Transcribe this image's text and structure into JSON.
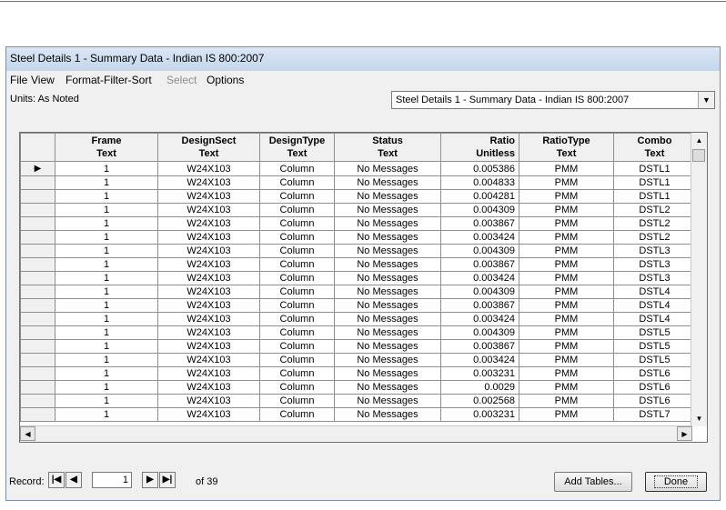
{
  "window": {
    "title": "Steel Details 1 - Summary Data - Indian IS 800:2007"
  },
  "menu": [
    {
      "label": "File",
      "enabled": true
    },
    {
      "label": "View",
      "enabled": true
    },
    {
      "label": "Format-Filter-Sort",
      "enabled": true
    },
    {
      "label": "Select",
      "enabled": false
    },
    {
      "label": "Options",
      "enabled": true
    }
  ],
  "units_label": "Units: As Noted",
  "table_select": {
    "value": "Steel Details 1 - Summary Data - Indian IS 800:2007"
  },
  "grid": {
    "columns": [
      {
        "name": "Frame",
        "unit": "Text"
      },
      {
        "name": "DesignSect",
        "unit": "Text"
      },
      {
        "name": "DesignType",
        "unit": "Text"
      },
      {
        "name": "Status",
        "unit": "Text"
      },
      {
        "name": "Ratio",
        "unit": "Unitless"
      },
      {
        "name": "RatioType",
        "unit": "Text"
      },
      {
        "name": "Combo",
        "unit": "Text"
      }
    ],
    "rows": [
      [
        "1",
        "W24X103",
        "Column",
        "No Messages",
        "0.005386",
        "PMM",
        "DSTL1"
      ],
      [
        "1",
        "W24X103",
        "Column",
        "No Messages",
        "0.004833",
        "PMM",
        "DSTL1"
      ],
      [
        "1",
        "W24X103",
        "Column",
        "No Messages",
        "0.004281",
        "PMM",
        "DSTL1"
      ],
      [
        "1",
        "W24X103",
        "Column",
        "No Messages",
        "0.004309",
        "PMM",
        "DSTL2"
      ],
      [
        "1",
        "W24X103",
        "Column",
        "No Messages",
        "0.003867",
        "PMM",
        "DSTL2"
      ],
      [
        "1",
        "W24X103",
        "Column",
        "No Messages",
        "0.003424",
        "PMM",
        "DSTL2"
      ],
      [
        "1",
        "W24X103",
        "Column",
        "No Messages",
        "0.004309",
        "PMM",
        "DSTL3"
      ],
      [
        "1",
        "W24X103",
        "Column",
        "No Messages",
        "0.003867",
        "PMM",
        "DSTL3"
      ],
      [
        "1",
        "W24X103",
        "Column",
        "No Messages",
        "0.003424",
        "PMM",
        "DSTL3"
      ],
      [
        "1",
        "W24X103",
        "Column",
        "No Messages",
        "0.004309",
        "PMM",
        "DSTL4"
      ],
      [
        "1",
        "W24X103",
        "Column",
        "No Messages",
        "0.003867",
        "PMM",
        "DSTL4"
      ],
      [
        "1",
        "W24X103",
        "Column",
        "No Messages",
        "0.003424",
        "PMM",
        "DSTL4"
      ],
      [
        "1",
        "W24X103",
        "Column",
        "No Messages",
        "0.004309",
        "PMM",
        "DSTL5"
      ],
      [
        "1",
        "W24X103",
        "Column",
        "No Messages",
        "0.003867",
        "PMM",
        "DSTL5"
      ],
      [
        "1",
        "W24X103",
        "Column",
        "No Messages",
        "0.003424",
        "PMM",
        "DSTL5"
      ],
      [
        "1",
        "W24X103",
        "Column",
        "No Messages",
        "0.003231",
        "PMM",
        "DSTL6"
      ],
      [
        "1",
        "W24X103",
        "Column",
        "No Messages",
        "0.0029",
        "PMM",
        "DSTL6"
      ],
      [
        "1",
        "W24X103",
        "Column",
        "No Messages",
        "0.002568",
        "PMM",
        "DSTL6"
      ],
      [
        "1",
        "W24X103",
        "Column",
        "No Messages",
        "0.003231",
        "PMM",
        "DSTL7"
      ]
    ],
    "current_row_marker": "▶"
  },
  "footer": {
    "record_label": "Record:",
    "record_value": "1",
    "of_label": "of 39",
    "add_tables_label": "Add Tables...",
    "done_label": "Done"
  }
}
